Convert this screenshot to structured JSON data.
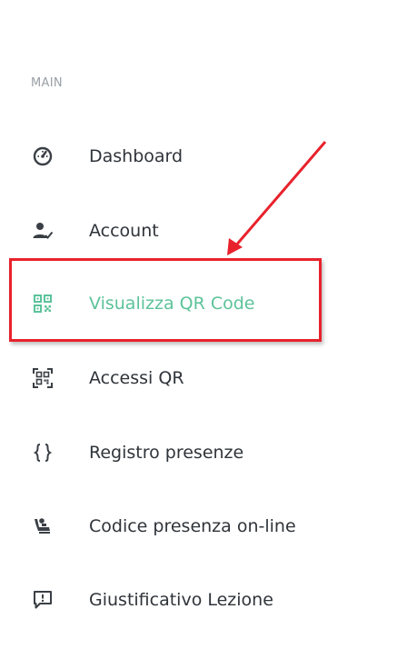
{
  "sidebar": {
    "section_title": "MAIN",
    "items": [
      {
        "label": "Dashboard",
        "icon": "speedometer-icon"
      },
      {
        "label": "Account",
        "icon": "user-check-icon"
      },
      {
        "label": "Visualizza QR Code",
        "icon": "qr-code-icon",
        "active": true
      },
      {
        "label": "Accessi QR",
        "icon": "qr-scan-icon"
      },
      {
        "label": "Registro presenze",
        "icon": "curly-braces-icon"
      },
      {
        "label": "Codice presenza on-line",
        "icon": "seat-icon"
      },
      {
        "label": "Giustificativo Lezione",
        "icon": "comment-alert-icon"
      }
    ]
  },
  "colors": {
    "active": "#5cc39a",
    "text": "#2f343a",
    "muted": "#9aa0a6",
    "annotation": "#e8222c"
  }
}
